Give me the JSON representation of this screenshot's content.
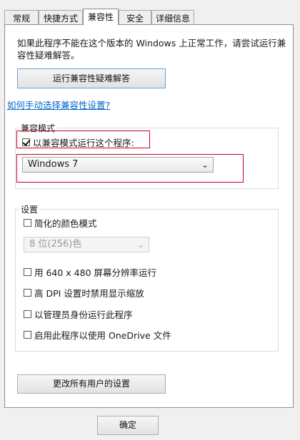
{
  "tabs": [
    {
      "label": "常规",
      "active": false
    },
    {
      "label": "快捷方式",
      "active": false
    },
    {
      "label": "兼容性",
      "active": true
    },
    {
      "label": "安全",
      "active": false
    },
    {
      "label": "详细信息",
      "active": false
    }
  ],
  "intro_text": "如果此程序不能在这个版本的 Windows 上正常工作，请尝试运行兼容性疑难解答。",
  "troubleshoot_button": "运行兼容性疑难解答",
  "manual_link": "如何手动选择兼容性设置?",
  "compat_mode": {
    "group_title": "兼容模式",
    "checkbox_label": "以兼容模式运行这个程序:",
    "checked": true,
    "selected_os": "Windows 7"
  },
  "settings": {
    "group_title": "设置",
    "reduced_color": {
      "label": "简化的颜色模式",
      "checked": false
    },
    "color_depth": "8 位(256)色",
    "res_640": {
      "label": "用 640 x 480 屏幕分辨率运行",
      "checked": false
    },
    "high_dpi": {
      "label": "高 DPI 设置时禁用显示缩放",
      "checked": false
    },
    "run_admin": {
      "label": "以管理员身份运行此程序",
      "checked": false
    },
    "onedrive": {
      "label": "启用此程序以使用 OneDrive 文件",
      "checked": false
    }
  },
  "all_users_button": "更改所有用户的设置",
  "ok_button": "确定",
  "colors": {
    "highlight_box": "#c8002a",
    "link": "#0066cc"
  }
}
